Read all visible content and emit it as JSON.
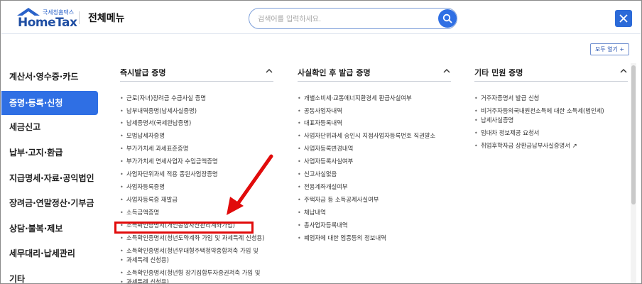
{
  "header": {
    "logo_small": "국세청홈택스",
    "logo_main": "HomeTax",
    "title": "전체메뉴",
    "search_placeholder": "검색어를 입력하세요."
  },
  "expand_all": "모두 열기 +",
  "sidebar": {
    "items": [
      {
        "label": "계산서·영수증·카드",
        "active": false
      },
      {
        "label": "증명·등록·신청",
        "active": true
      },
      {
        "label": "세금신고",
        "active": false
      },
      {
        "label": "납부·고지·환급",
        "active": false
      },
      {
        "label": "지급명세·자료·공익법인",
        "active": false
      },
      {
        "label": "장려금·연말정산·기부금",
        "active": false
      },
      {
        "label": "상담·불복·제보",
        "active": false
      },
      {
        "label": "세무대리·납세관리",
        "active": false
      },
      {
        "label": "기타",
        "active": false
      }
    ]
  },
  "columns": [
    {
      "title": "즉시발급 증명",
      "items": [
        "근로(자녀)장려금 수급사실 증명",
        "납부내역증명(납세사실증명)",
        "납세증명서(국세완납증명)",
        "모범납세자증명",
        "부가가치세 과세표준증명",
        "부가가치세 면세사업자 수입금액증명",
        "사업자단위과세 적용 종된사업장증명",
        "사업자등록증명",
        "사업자등록증 재발급",
        "소득금액증명",
        "소득확인증명서(개인종합자산관리계좌가입)",
        "소득확인증명서(청년도약계좌 가입 및 과세특례 신청용)",
        "소득확인증명서(청년우대형주택청약종합저축 가입 및",
        "과세특례 신청용)",
        "소득확인증명서(청년형 장기집합투자증권저축 가입 및",
        "과세특례 신청용)"
      ]
    },
    {
      "title": "사실확인 후 발급 증명",
      "items": [
        "개별소비세·교통에너지환경세 환급사실여부",
        "공동사업자내역",
        "대표자등록내역",
        "사업자단위과세 승인시 지점사업자등록번호 직권말소",
        "사업자등록변경내역",
        "사업자등록사실여부",
        "신고사실없음",
        "전용계좌개설여부",
        "주택자금 등 소득공제사실여부",
        "체납내역",
        "총사업자등록내역",
        "폐업자에 대한 업종등의 정보내역"
      ]
    },
    {
      "title": "기타 민원 증명",
      "items": [
        "거주자증명서 발급 신청",
        "비거주자등의국내원천소득에 대한 소득세(법인세)",
        "납세사실증명",
        "임대차 정보제공 요청서",
        "취업후학자금 상환금납부사실증명서 ↗"
      ]
    }
  ]
}
